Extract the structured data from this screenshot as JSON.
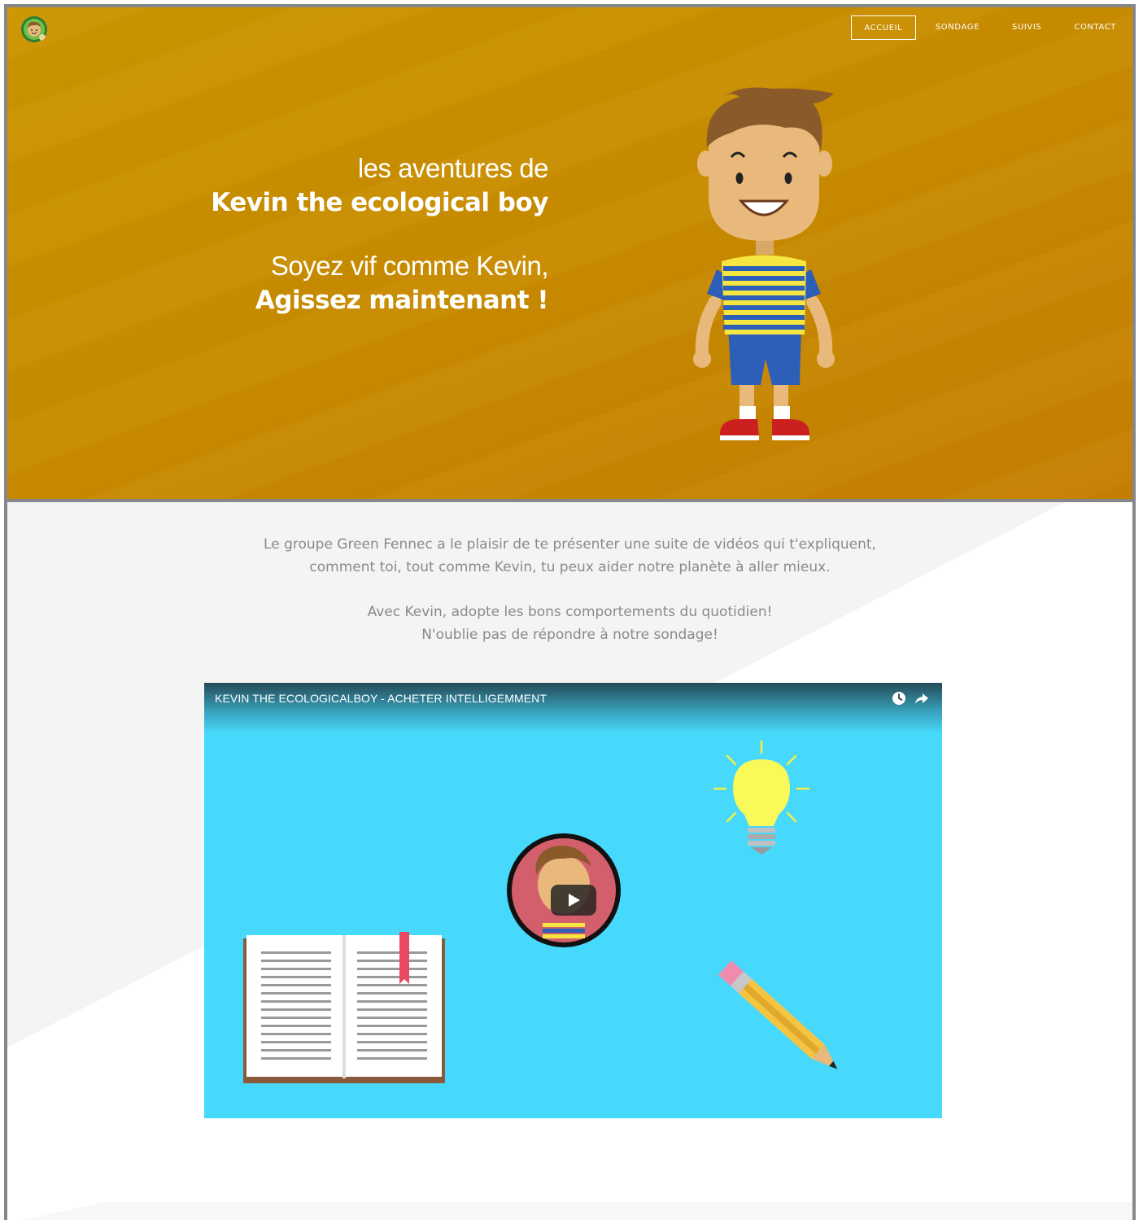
{
  "nav": {
    "items": [
      {
        "label": "ACCUEIL",
        "active": true
      },
      {
        "label": "SONDAGE",
        "active": false
      },
      {
        "label": "SUIVIS",
        "active": false
      },
      {
        "label": "CONTACT",
        "active": false
      }
    ]
  },
  "hero": {
    "line1": "les aventures de",
    "line2": "Kevin the ecological boy",
    "line3": "Soyez vif comme Kevin,",
    "line4": "Agissez maintenant !",
    "background": "#c98b00"
  },
  "intro": {
    "p1_l1": "Le groupe Green Fennec a le plaisir de te présenter une suite de vidéos qui t'expliquent,",
    "p1_l2": "comment toi, tout comme Kevin, tu peux aider notre planète à aller mieux.",
    "p2_l1": "Avec Kevin, adopte les bons comportements du quotidien!",
    "p2_l2": "N'oublie pas de répondre à notre sondage!"
  },
  "video": {
    "title": "KEVIN THE ECOLOGICALBOY - ACHETER INTELLIGEMMENT",
    "icons": [
      "watch-later-icon",
      "share-icon",
      "play-icon"
    ],
    "background": "#46d9fb"
  }
}
